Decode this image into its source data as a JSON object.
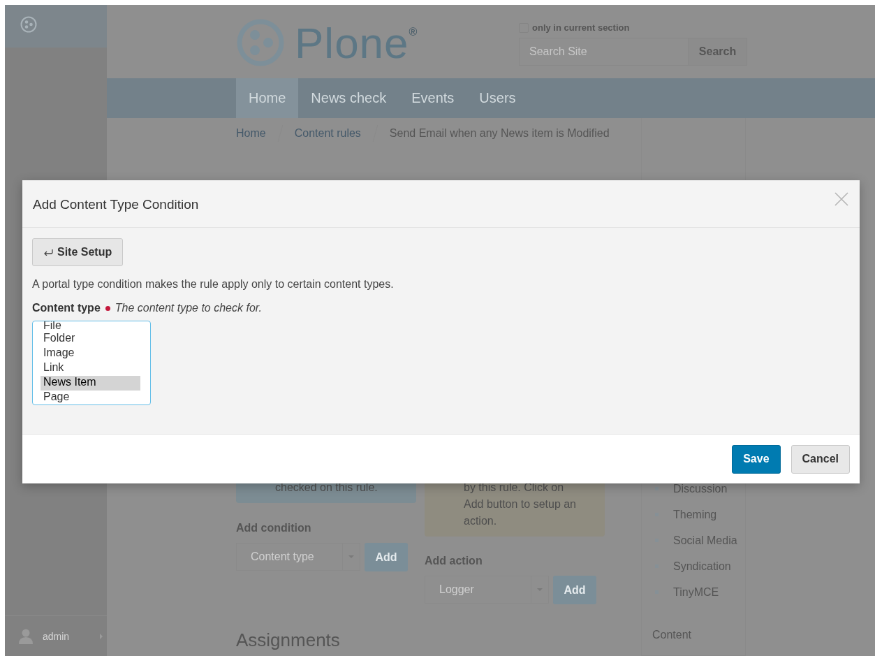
{
  "toolbar": {
    "user": "admin"
  },
  "header": {
    "logo_text": "Plone$^{®}$",
    "search": {
      "scope": {
        "label": "only in current section",
        "checked": false
      },
      "placeholder": "Search Site",
      "button": "Search"
    }
  },
  "nav": [
    {
      "label": "Home",
      "selected": true
    },
    {
      "label": "News check",
      "selected": false
    },
    {
      "label": "Events",
      "selected": false
    },
    {
      "label": "Users",
      "selected": false
    }
  ],
  "breadcrumbs": [
    "Home",
    "Content rules",
    "Send Email when any News item is Modified"
  ],
  "conditions": {
    "info": "checked on this rule.",
    "add_label": "Add condition",
    "select_value": "Content type",
    "add_button": "Add"
  },
  "actions": {
    "info": "by this rule. Click on Add button to setup an action.",
    "add_label": "Add action",
    "select_value": "Logger",
    "add_button": "Add"
  },
  "assignments_heading": "Assignments",
  "portlet": {
    "items": [
      "Discussion",
      "Theming",
      "Social Media",
      "Syndication",
      "TinyMCE"
    ],
    "section": "Content"
  },
  "dialog": {
    "title": "Add Content Type Condition",
    "back_button": "Site Setup",
    "description": "A portal type condition makes the rule apply only to certain content types.",
    "field": {
      "label": "Content type",
      "required": true,
      "help": "The content type to check for.",
      "options": [
        {
          "label": "File",
          "selected": false
        },
        {
          "label": "Folder",
          "selected": false
        },
        {
          "label": "Image",
          "selected": false
        },
        {
          "label": "Link",
          "selected": false
        },
        {
          "label": "News Item",
          "selected": true
        },
        {
          "label": "Page",
          "selected": false
        }
      ]
    },
    "buttons": [
      {
        "label": "Save",
        "kind": "primary"
      },
      {
        "label": "Cancel",
        "kind": "secondary"
      }
    ]
  }
}
